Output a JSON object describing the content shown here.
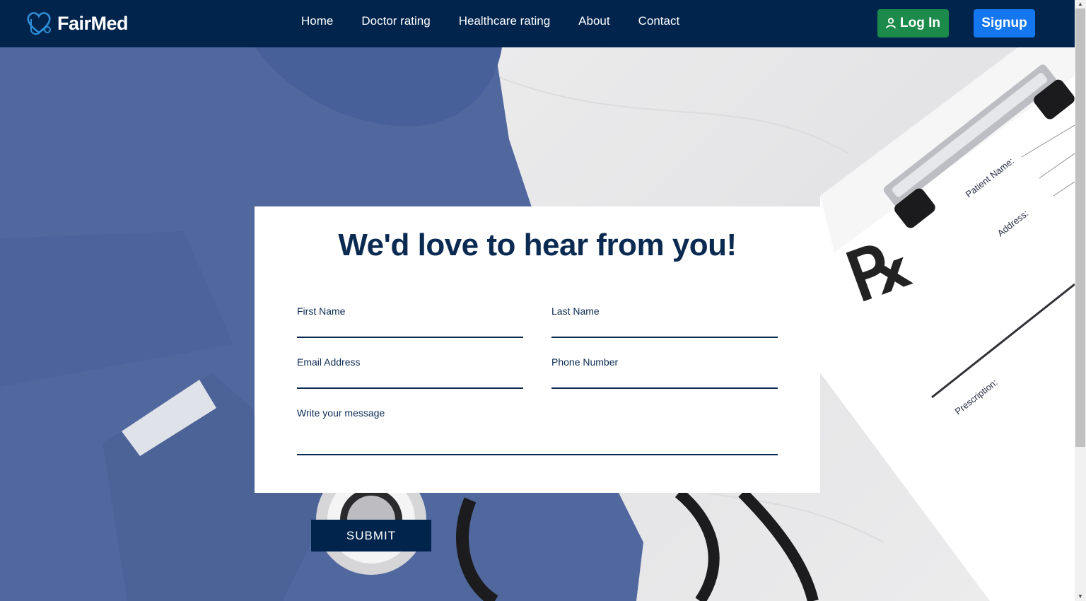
{
  "nav": {
    "brand": "FairMed",
    "links": [
      "Home",
      "Doctor rating",
      "Healthcare rating",
      "About",
      "Contact"
    ],
    "login_label": "Log In",
    "signup_label": "Signup"
  },
  "form": {
    "title": "We'd love to hear from you!",
    "first_name_label": "First Name",
    "last_name_label": "Last Name",
    "email_label": "Email Address",
    "phone_label": "Phone Number",
    "message_label": "Write your message",
    "submit_label": "SUBMIT"
  },
  "background": {
    "clipboard_patient": "Patient Name:",
    "clipboard_address": "Address:",
    "clipboard_rx": "℞",
    "clipboard_prescription": "Prescription:"
  },
  "colors": {
    "navbar": "#01244d",
    "login": "#1b8a4a",
    "signup": "#1477f0",
    "title": "#0a2a52",
    "scrubs": "#51689f"
  }
}
